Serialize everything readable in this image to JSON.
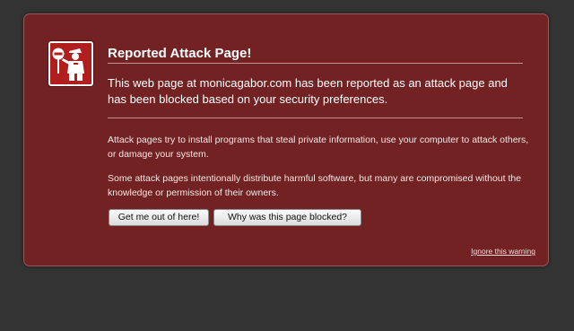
{
  "colors": {
    "background": "#333333",
    "panel": "#722222",
    "badge": "#b01e1e"
  },
  "icon": "attack-site-guard-icon",
  "title": "Reported Attack Page!",
  "lead": "This web page at monicagabor.com has been reported as an attack page and has been blocked based on your security preferences.",
  "paragraphs": {
    "p1": "Attack pages try to install programs that steal private information, use your computer to attack others, or damage your system.",
    "p2": "Some attack pages intentionally distribute harmful software, but many are compromised without the knowledge or permission of their owners."
  },
  "buttons": {
    "get_out": "Get me out of here!",
    "why_blocked": "Why was this page blocked?"
  },
  "ignore_link": "Ignore this warning"
}
